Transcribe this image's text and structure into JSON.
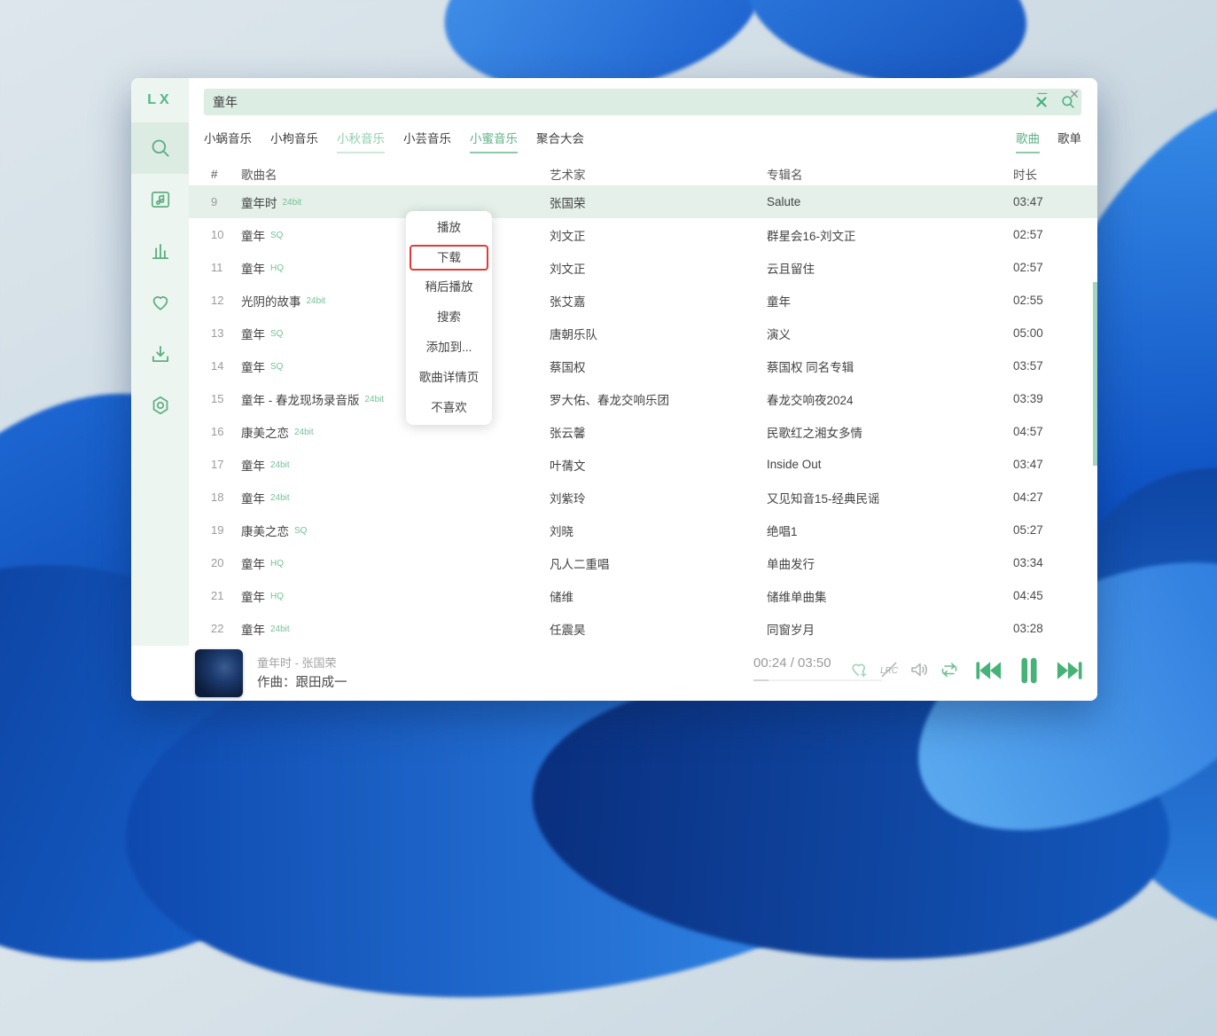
{
  "app": {
    "logo": "LX",
    "window_controls": {
      "minimize": "─",
      "close": "✕"
    }
  },
  "colors": {
    "accent_green": "#53ad7e",
    "accent_light_green": "#8ecfae",
    "control_green": "#47b277",
    "row_highlight": "#e4f0e9",
    "menu_highlight_red": "#e53935",
    "sidebar_bg": "#ecf5f0"
  },
  "sidebar": {
    "items": [
      {
        "id": "search",
        "icon": "search-icon",
        "active": true
      },
      {
        "id": "songlist",
        "icon": "music-list-icon",
        "active": false
      },
      {
        "id": "leaderboard",
        "icon": "chart-bars-icon",
        "active": false
      },
      {
        "id": "love",
        "icon": "heart-icon",
        "active": false
      },
      {
        "id": "download",
        "icon": "download-icon",
        "active": false
      },
      {
        "id": "settings",
        "icon": "settings-icon",
        "active": false
      }
    ]
  },
  "search": {
    "value": "童年",
    "clear_icon": "clear-x-icon",
    "submit_icon": "search-icon"
  },
  "source_tabs": [
    {
      "id": "xiaowo",
      "label": "小蜗音乐",
      "state": "normal"
    },
    {
      "id": "xiaogou",
      "label": "小枸音乐",
      "state": "normal"
    },
    {
      "id": "xiaoqiu",
      "label": "小秋音乐",
      "state": "available"
    },
    {
      "id": "xiaoyun",
      "label": "小芸音乐",
      "state": "normal"
    },
    {
      "id": "xiaomi",
      "label": "小蜜音乐",
      "state": "active"
    },
    {
      "id": "juhe",
      "label": "聚合大会",
      "state": "normal"
    }
  ],
  "type_tabs": [
    {
      "id": "songs",
      "label": "歌曲",
      "active": true
    },
    {
      "id": "playlists",
      "label": "歌单",
      "active": false
    }
  ],
  "table": {
    "headers": {
      "num": "#",
      "name": "歌曲名",
      "artist": "艺术家",
      "album": "专辑名",
      "duration": "时长"
    },
    "rows": [
      {
        "num": "9",
        "name": "童年时",
        "quality": "24bit",
        "artist": "张国荣",
        "album": "Salute",
        "duration": "03:47",
        "highlighted": true
      },
      {
        "num": "10",
        "name": "童年",
        "quality": "SQ",
        "artist": "刘文正",
        "album": "群星会16-刘文正",
        "duration": "02:57"
      },
      {
        "num": "11",
        "name": "童年",
        "quality": "HQ",
        "artist": "刘文正",
        "album": "云且留住",
        "duration": "02:57"
      },
      {
        "num": "12",
        "name": "光阴的故事",
        "quality": "24bit",
        "artist": "张艾嘉",
        "album": "童年",
        "duration": "02:55"
      },
      {
        "num": "13",
        "name": "童年",
        "quality": "SQ",
        "artist": "唐朝乐队",
        "album": "演义",
        "duration": "05:00"
      },
      {
        "num": "14",
        "name": "童年",
        "quality": "SQ",
        "artist": "蔡国权",
        "album": "蔡国权 同名专辑",
        "duration": "03:57"
      },
      {
        "num": "15",
        "name": "童年 - 春龙现场录音版",
        "quality": "24bit",
        "artist": "罗大佑、春龙交响乐团",
        "album": "春龙交响夜2024",
        "duration": "03:39"
      },
      {
        "num": "16",
        "name": "康美之恋",
        "quality": "24bit",
        "artist": "张云馨",
        "album": "民歌红之湘女多情",
        "duration": "04:57"
      },
      {
        "num": "17",
        "name": "童年",
        "quality": "24bit",
        "artist": "叶蒨文",
        "album": "Inside Out",
        "duration": "03:47"
      },
      {
        "num": "18",
        "name": "童年",
        "quality": "24bit",
        "artist": "刘紫玲",
        "album": "又见知音15-经典民谣",
        "duration": "04:27"
      },
      {
        "num": "19",
        "name": "康美之恋",
        "quality": "SQ",
        "artist": "刘晓",
        "album": "绝唱1",
        "duration": "05:27"
      },
      {
        "num": "20",
        "name": "童年",
        "quality": "HQ",
        "artist": "凡人二重唱",
        "album": "单曲发行",
        "duration": "03:34"
      },
      {
        "num": "21",
        "name": "童年",
        "quality": "HQ",
        "artist": "储维",
        "album": "储维单曲集",
        "duration": "04:45"
      },
      {
        "num": "22",
        "name": "童年",
        "quality": "24bit",
        "artist": "任震昊",
        "album": "同窗岁月",
        "duration": "03:28"
      }
    ]
  },
  "context_menu": {
    "items": [
      {
        "id": "play",
        "label": "播放"
      },
      {
        "id": "download",
        "label": "下载",
        "highlighted": true
      },
      {
        "id": "play-later",
        "label": "稍后播放"
      },
      {
        "id": "search",
        "label": "搜索"
      },
      {
        "id": "add-to",
        "label": "添加到..."
      },
      {
        "id": "song-detail",
        "label": "歌曲详情页"
      },
      {
        "id": "dislike",
        "label": "不喜欢"
      }
    ]
  },
  "player": {
    "title": "童年时 - 张国荣",
    "subtitle": "作曲：跟田成一",
    "time": "00:24 / 03:50",
    "icons": [
      "favorite-heart-plus-icon",
      "desktop-lyrics-icon",
      "volume-icon",
      "repeat-icon",
      "previous-track-icon",
      "pause-icon",
      "next-track-icon"
    ]
  }
}
